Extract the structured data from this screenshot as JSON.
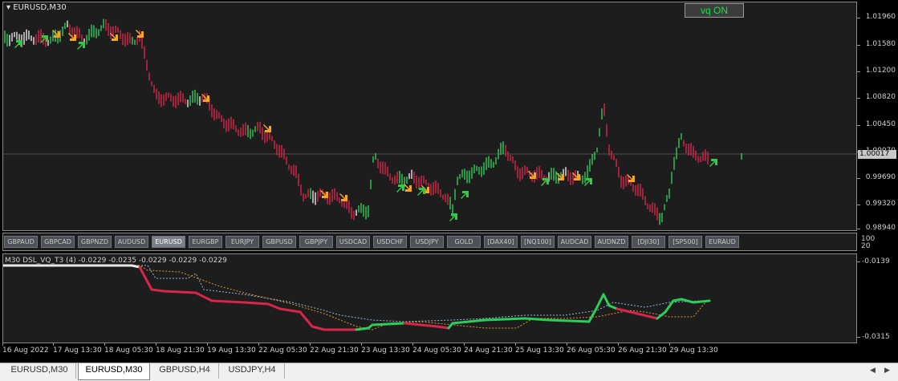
{
  "main": {
    "symbol_title": "EURUSD,M30",
    "vq_button_label": "vq ON",
    "current_price": "1.00017",
    "price_labels": [
      "1.01960",
      "1.01580",
      "1.01200",
      "1.00820",
      "1.00450",
      "1.00070",
      "0.99690",
      "0.99320",
      "0.98940"
    ],
    "colors": {
      "up": "#2ecc5a",
      "down": "#d8254a",
      "neutral": "#e8e8e8",
      "arrow_up": "#2ecc40",
      "arrow_down": "#f5a623"
    }
  },
  "symbol_buttons": {
    "items": [
      "GBPAUD",
      "GBPCAD",
      "GBPNZD",
      "AUDUSD",
      "EURUSD",
      "EURGBP",
      "EURJPY",
      "GBPUSD",
      "GBPJPY",
      "USDCAD",
      "USDCHF",
      "USDJPY",
      "GOLD",
      "[DAX40]",
      "[NQ100]",
      "AUDCAD",
      "AUDNZD",
      "[DJI30]",
      "[SP500]",
      "EURAUD"
    ],
    "active": "EURUSD",
    "scale_labels": [
      "100",
      "20"
    ]
  },
  "indicator": {
    "title": "M30 DSL_VQ_T3 (4) -0.0229 -0.0235 -0.0229 -0.0229 -0.0229",
    "scale_labels": [
      "-0.0139",
      "-0.0315"
    ]
  },
  "time_axis": {
    "labels": [
      "16 Aug 2022",
      "17 Aug 13:30",
      "18 Aug 05:30",
      "18 Aug 21:30",
      "19 Aug 13:30",
      "22 Aug 05:30",
      "22 Aug 21:30",
      "23 Aug 13:30",
      "24 Aug 05:30",
      "24 Aug 21:30",
      "25 Aug 13:30",
      "26 Aug 05:30",
      "26 Aug 21:30",
      "29 Aug 13:30"
    ]
  },
  "tabs": {
    "items": [
      "EURUSD,M30",
      "EURUSD,M30",
      "GBPUSD,H4",
      "USDJPY,H4"
    ],
    "active_index": 1
  }
}
